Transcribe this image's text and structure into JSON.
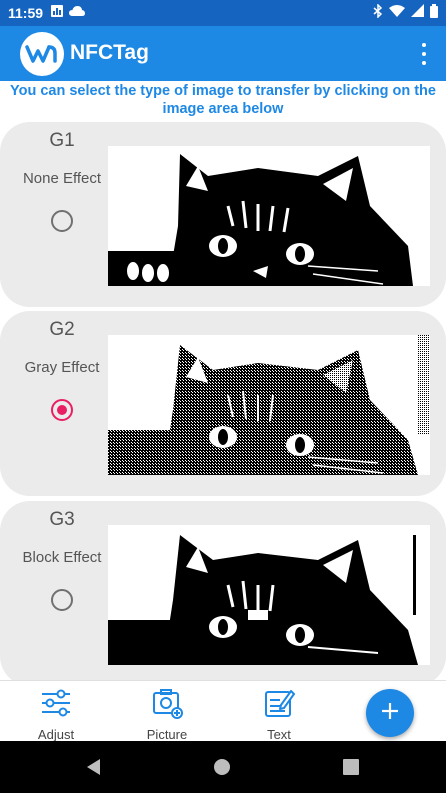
{
  "status_bar": {
    "time": "11:59",
    "left_icons": [
      "analytics-icon",
      "cloud-icon"
    ],
    "right_icons": [
      "bluetooth-icon",
      "wifi-icon",
      "signal-icon",
      "battery-icon"
    ]
  },
  "app_bar": {
    "logo_icon": "waveshare-logo-icon",
    "title": "NFCTag",
    "menu_icon": "overflow-menu-icon"
  },
  "instruction": "You can select the type of image to transfer by clicking on the image area below",
  "cards": [
    {
      "group": "G1",
      "effect": "None Effect",
      "selected": false
    },
    {
      "group": "G2",
      "effect": "Gray Effect",
      "selected": true
    },
    {
      "group": "G3",
      "effect": "Block Effect",
      "selected": false
    }
  ],
  "bottom_nav": {
    "items": [
      {
        "label": "Adjust",
        "icon": "sliders-icon"
      },
      {
        "label": "Picture",
        "icon": "add-photo-icon"
      },
      {
        "label": "Text",
        "icon": "edit-text-icon"
      }
    ],
    "fab_icon": "plus-icon"
  },
  "system_nav": {
    "icons": [
      "back-icon",
      "home-icon",
      "recents-icon"
    ]
  },
  "colors": {
    "status_bar": "#1565c0",
    "app_bar": "#1e88e5",
    "accent": "#e91e63",
    "card_bg": "#ebebeb"
  }
}
